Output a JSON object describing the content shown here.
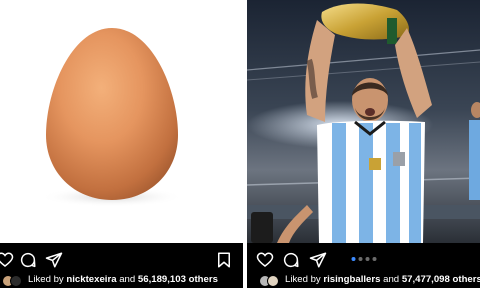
{
  "left_post": {
    "image_icon": "egg-photo",
    "liked_by_prefix": "Liked by",
    "liked_by_user": "nicktexeira",
    "and_text": "and",
    "likes_count": "56,189,103 others",
    "icons": [
      "heart-icon",
      "comment-icon",
      "share-icon",
      "bookmark-icon"
    ]
  },
  "right_post": {
    "image_icon": "trophy-celebration-photo",
    "liked_by_prefix": "Liked by",
    "liked_by_user": "risingballers",
    "and_text": "and",
    "likes_count": "57,477,098 others",
    "carousel_total": 4,
    "carousel_active": 1,
    "icons": [
      "heart-icon",
      "comment-icon",
      "share-icon"
    ]
  },
  "colors": {
    "background": "#000000",
    "text": "#ffffff",
    "carousel_active": "#3d8bff",
    "egg": "#e5955f"
  }
}
